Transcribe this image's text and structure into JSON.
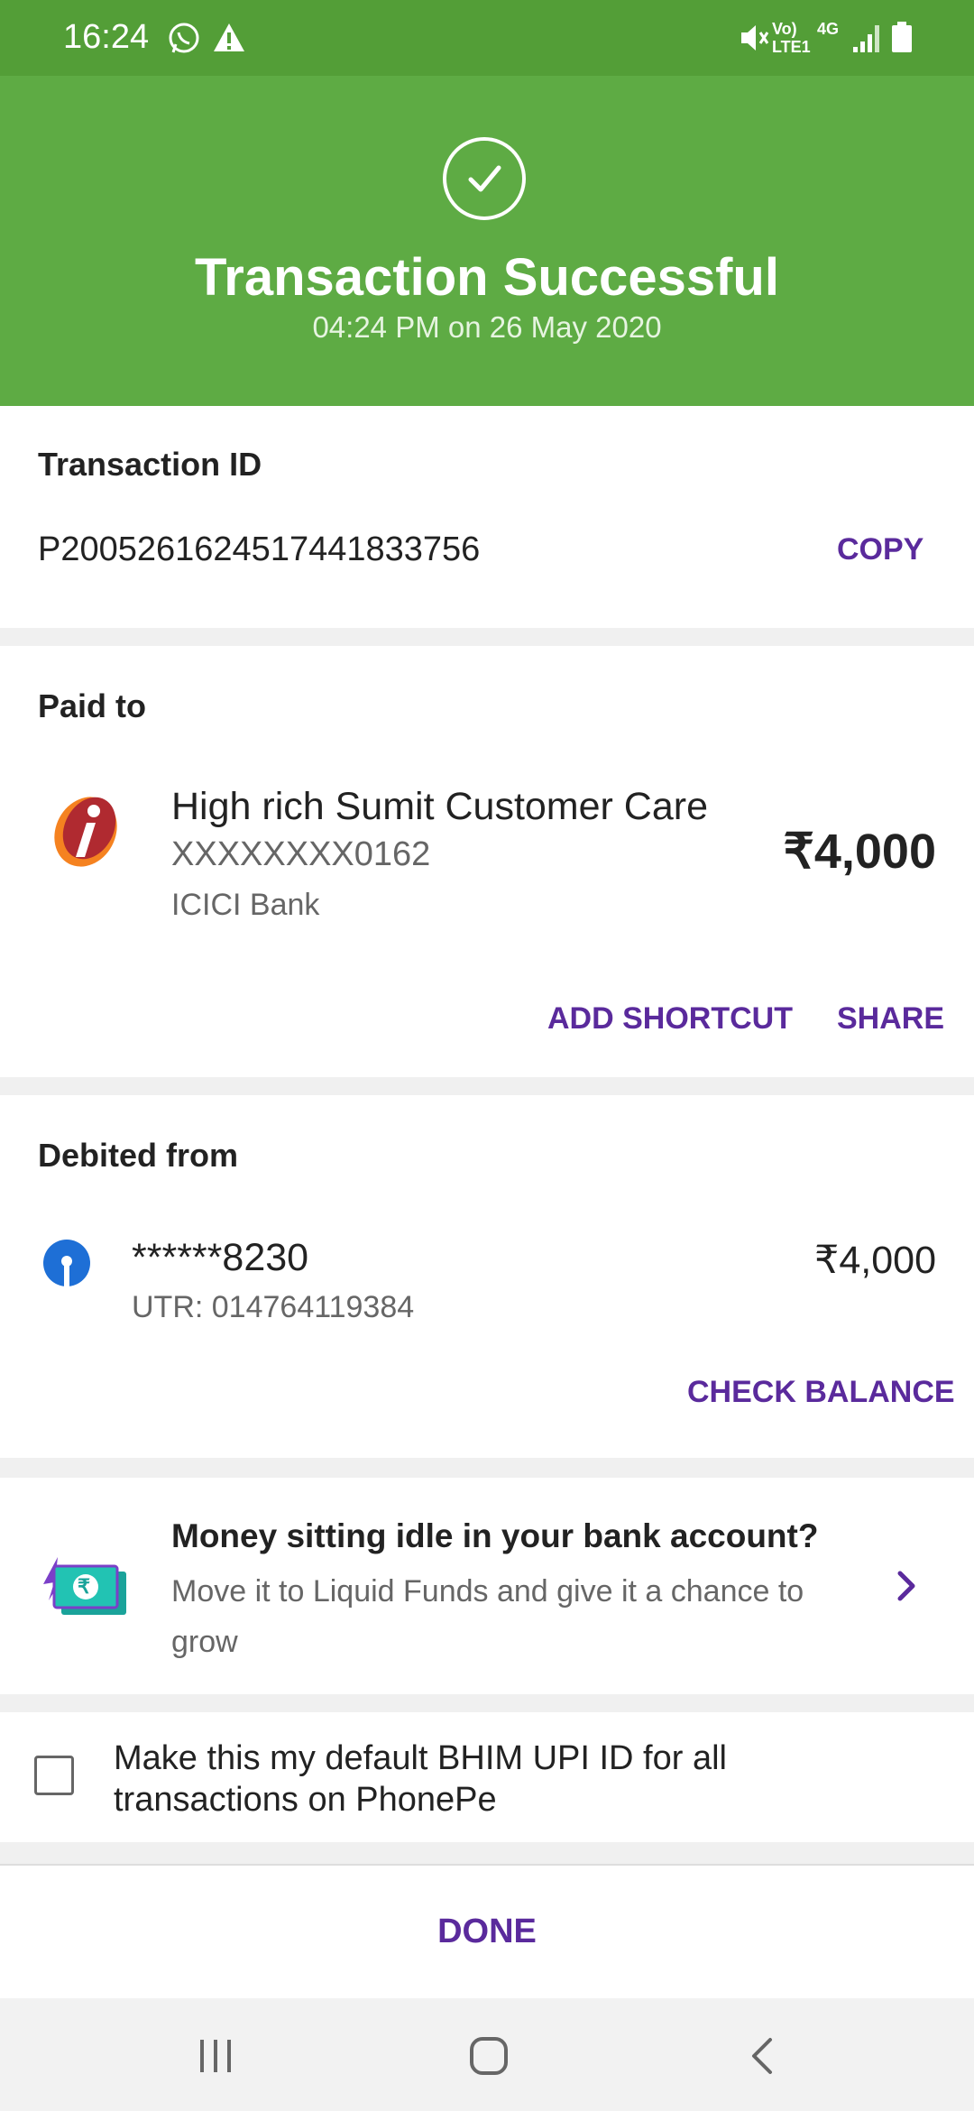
{
  "status_bar": {
    "time": "16:24",
    "network_label": "Vo) LTE1",
    "network_type": "4G"
  },
  "header": {
    "title": "Transaction Successful",
    "subtitle": "04:24 PM on 26 May 2020"
  },
  "transaction": {
    "label": "Transaction ID",
    "id": "P2005261624517441833756",
    "copy_label": "COPY"
  },
  "paid_to": {
    "label": "Paid to",
    "name": "High rich Sumit Customer Care",
    "account": "XXXXXXXX0162",
    "bank": "ICICI Bank",
    "amount": "₹4,000",
    "add_shortcut_label": "ADD SHORTCUT",
    "share_label": "SHARE"
  },
  "debited_from": {
    "label": "Debited from",
    "account": "******8230",
    "utr": "UTR: 014764119384",
    "amount": "₹4,000",
    "check_balance_label": "CHECK BALANCE"
  },
  "promo": {
    "title": "Money sitting idle in your bank account?",
    "body": "Move it to Liquid Funds and give it a chance to grow",
    "icon_symbol": "₹"
  },
  "default_upi": {
    "text": "Make this my default BHIM UPI ID for all transactions on PhonePe",
    "checked": false
  },
  "done_label": "DONE",
  "colors": {
    "header_green": "#5eab44",
    "status_green": "#539e37",
    "accent_purple": "#5a2a9c"
  }
}
